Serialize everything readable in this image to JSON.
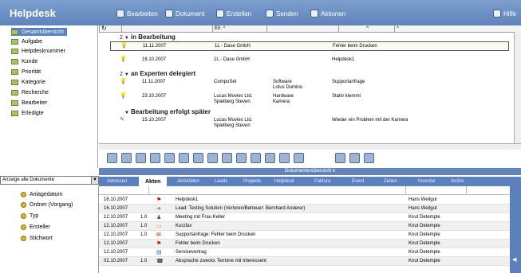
{
  "header": {
    "title": "Helpdesk",
    "toolbar": [
      {
        "label": "Bearbeiten",
        "icon": "pen-icon"
      },
      {
        "label": "Dokument",
        "icon": "document-icon"
      },
      {
        "label": "Erstellen",
        "icon": "create-icon"
      },
      {
        "label": "Senden",
        "icon": "send-icon"
      },
      {
        "label": "Aktionen",
        "icon": "actions-icon"
      }
    ],
    "help_label": "Hilfe"
  },
  "nav": {
    "items": [
      {
        "label": "Gesamtübersicht",
        "selected": true
      },
      {
        "label": "Aufgabe"
      },
      {
        "label": "Helpdesknummer"
      },
      {
        "label": "Kunde"
      },
      {
        "label": "Priorität"
      },
      {
        "label": "Kategorie"
      },
      {
        "label": "Recherche"
      },
      {
        "label": "Bearbeiter"
      },
      {
        "label": "Erledigte"
      }
    ]
  },
  "list": {
    "columns": [
      "Erl. ^",
      "^",
      "^"
    ],
    "groups": [
      {
        "count": "2",
        "title": "in Bearbeitung",
        "rows": [
          {
            "date": "11.11.2007",
            "company": "1L - Dase GmbH",
            "topic": "",
            "subject": "Fehler beim Drucken",
            "selected": true
          },
          {
            "date": "16.10.2007",
            "company": "1L - Dase GmbH",
            "topic": "",
            "subject": "Helpdesk1"
          }
        ]
      },
      {
        "count": "2",
        "title": "an Experten delegiert",
        "rows": [
          {
            "date": "11.11.2007",
            "company": "CompuSet",
            "topic": "Software",
            "topic2": "Lotus Domino",
            "subject": "Supportanfrage"
          },
          {
            "date": "23.10.2007",
            "company": "Lucas Movies Ltd.",
            "company2": "Spielberg Steven",
            "topic": "Hardware",
            "topic2": "Kamera",
            "subject": "Stativ klemmt"
          }
        ]
      },
      {
        "count": "",
        "title": "Bearbeitung erfolgt später",
        "rows": [
          {
            "date": "15.10.2007",
            "company": "Lucas Movies Ltd.",
            "company2": "Spielberg Steven",
            "topic": "",
            "subject": "Wieder ein Problem mit der Kamera"
          }
        ]
      }
    ]
  },
  "doc_bar": "Dokumentenübersicht ▾",
  "bottom": {
    "view_select": "Anzeige alle Dokumente",
    "nav": [
      "Anlagedatum",
      "Ordner (Vorgang)",
      "Typ",
      "Ersteller",
      "Stichwort"
    ],
    "tabs": [
      "Adressen",
      "Akten",
      "Aktivitäten",
      "Leads",
      "Projekte",
      "Helpdesk",
      "Faktura",
      "Event",
      "Zeiten",
      "Inventar",
      "Archiv"
    ],
    "active_tab": "Akten",
    "rows": [
      {
        "date": "16.10.2007",
        "ver": "",
        "icon": "flag-icon",
        "text": "Helpdesk1",
        "user": "Hans Weilgut"
      },
      {
        "date": "16.10.2007",
        "ver": "",
        "icon": "arrow-icon",
        "text": "Lead: Testing Solution (Verloren/Betreuer: Bernhard Anderer)",
        "user": "Hans Weilgut"
      },
      {
        "date": "12.10.2007",
        "ver": "1.0",
        "icon": "group-icon",
        "text": "Meeting mit Frau Keller",
        "user": "Knut Detemple"
      },
      {
        "date": "12.10.2007",
        "ver": "1.0",
        "icon": "folder-icon",
        "text": "Kurzfax",
        "user": "Knut Detemple"
      },
      {
        "date": "12.10.2007",
        "ver": "1.0",
        "icon": "mail-icon",
        "text": "Supportanfrage: Fehler beim Drucken",
        "user": "Knut Detemple"
      },
      {
        "date": "12.10.2007",
        "ver": "",
        "icon": "flag-icon",
        "text": "Fehler beim Drucken",
        "user": "Knut Detemple"
      },
      {
        "date": "12.10.2007",
        "ver": "",
        "icon": "doc-icon",
        "text": "Servicevertrag",
        "user": "Knut Detemple"
      },
      {
        "date": "02.10.2007",
        "ver": "1.0",
        "icon": "phone-icon",
        "text": "Absprache zwecks Termine mit Interessent",
        "user": "Knut Detemple"
      }
    ]
  },
  "colors": {
    "header": "#6b8fc4",
    "accent": "#5b80bc"
  }
}
